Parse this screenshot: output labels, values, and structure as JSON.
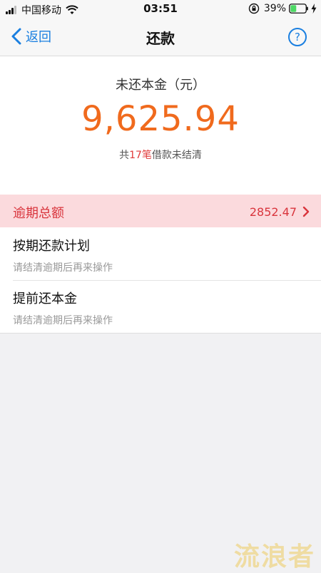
{
  "status_bar": {
    "carrier": "中国移动",
    "time": "03:51",
    "battery_percent": "39%",
    "battery_level": 0.39,
    "battery_color": "#4cd964"
  },
  "nav": {
    "back_label": "返回",
    "title": "还款",
    "help_label": "?"
  },
  "summary": {
    "label": "未还本金（元）",
    "amount": "9,625.94",
    "loans_prefix": "共",
    "loans_count": "17笔",
    "loans_suffix": "借款未结清"
  },
  "overdue": {
    "label": "逾期总额",
    "value": "2852.47"
  },
  "options": [
    {
      "title": "按期还款计划",
      "subtitle": "请结清逾期后再来操作"
    },
    {
      "title": "提前还本金",
      "subtitle": "请结清逾期后再来操作"
    }
  ],
  "watermark": "流浪者",
  "colors": {
    "accent": "#1a7fe0",
    "amount": "#f06a1d",
    "overdue_text": "#d9353d",
    "overdue_bg": "#fbdadd"
  }
}
